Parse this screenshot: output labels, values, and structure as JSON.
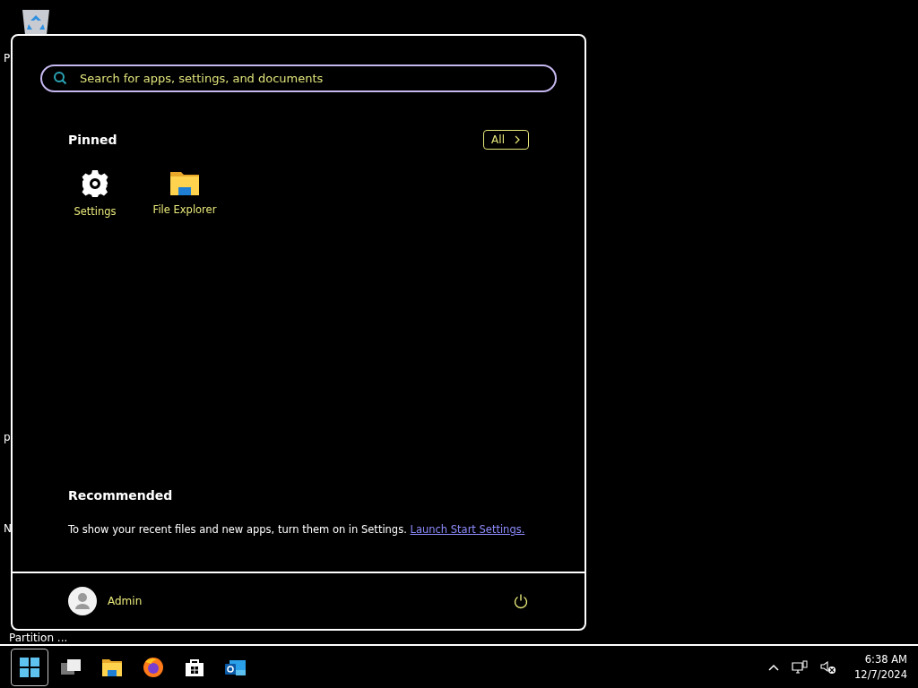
{
  "desktop": {
    "labels": [
      {
        "text": "P",
        "kind": "fragment"
      },
      {
        "text": "p",
        "kind": "fragment"
      },
      {
        "text": "N",
        "kind": "fragment"
      },
      {
        "text": "Partition ...",
        "kind": "label"
      }
    ]
  },
  "start_menu": {
    "search": {
      "placeholder": "Search for apps, settings, and documents"
    },
    "pinned": {
      "title": "Pinned",
      "all_button": "All",
      "apps": [
        {
          "label": "Settings",
          "kind": "settings"
        },
        {
          "label": "File Explorer",
          "kind": "folder"
        }
      ]
    },
    "recommended": {
      "title": "Recommended",
      "text": "To show your recent files and new apps, turn them on in Settings.",
      "link": "Launch Start Settings."
    },
    "user": {
      "name": "Admin"
    }
  },
  "taskbar": {
    "items": [
      {
        "kind": "start",
        "selected": true
      },
      {
        "kind": "taskview",
        "selected": false
      },
      {
        "kind": "folder",
        "selected": false
      },
      {
        "kind": "browser",
        "selected": false
      },
      {
        "kind": "store",
        "selected": false
      },
      {
        "kind": "mail",
        "selected": false
      }
    ],
    "time": "6:38 AM",
    "date": "12/7/2024"
  }
}
